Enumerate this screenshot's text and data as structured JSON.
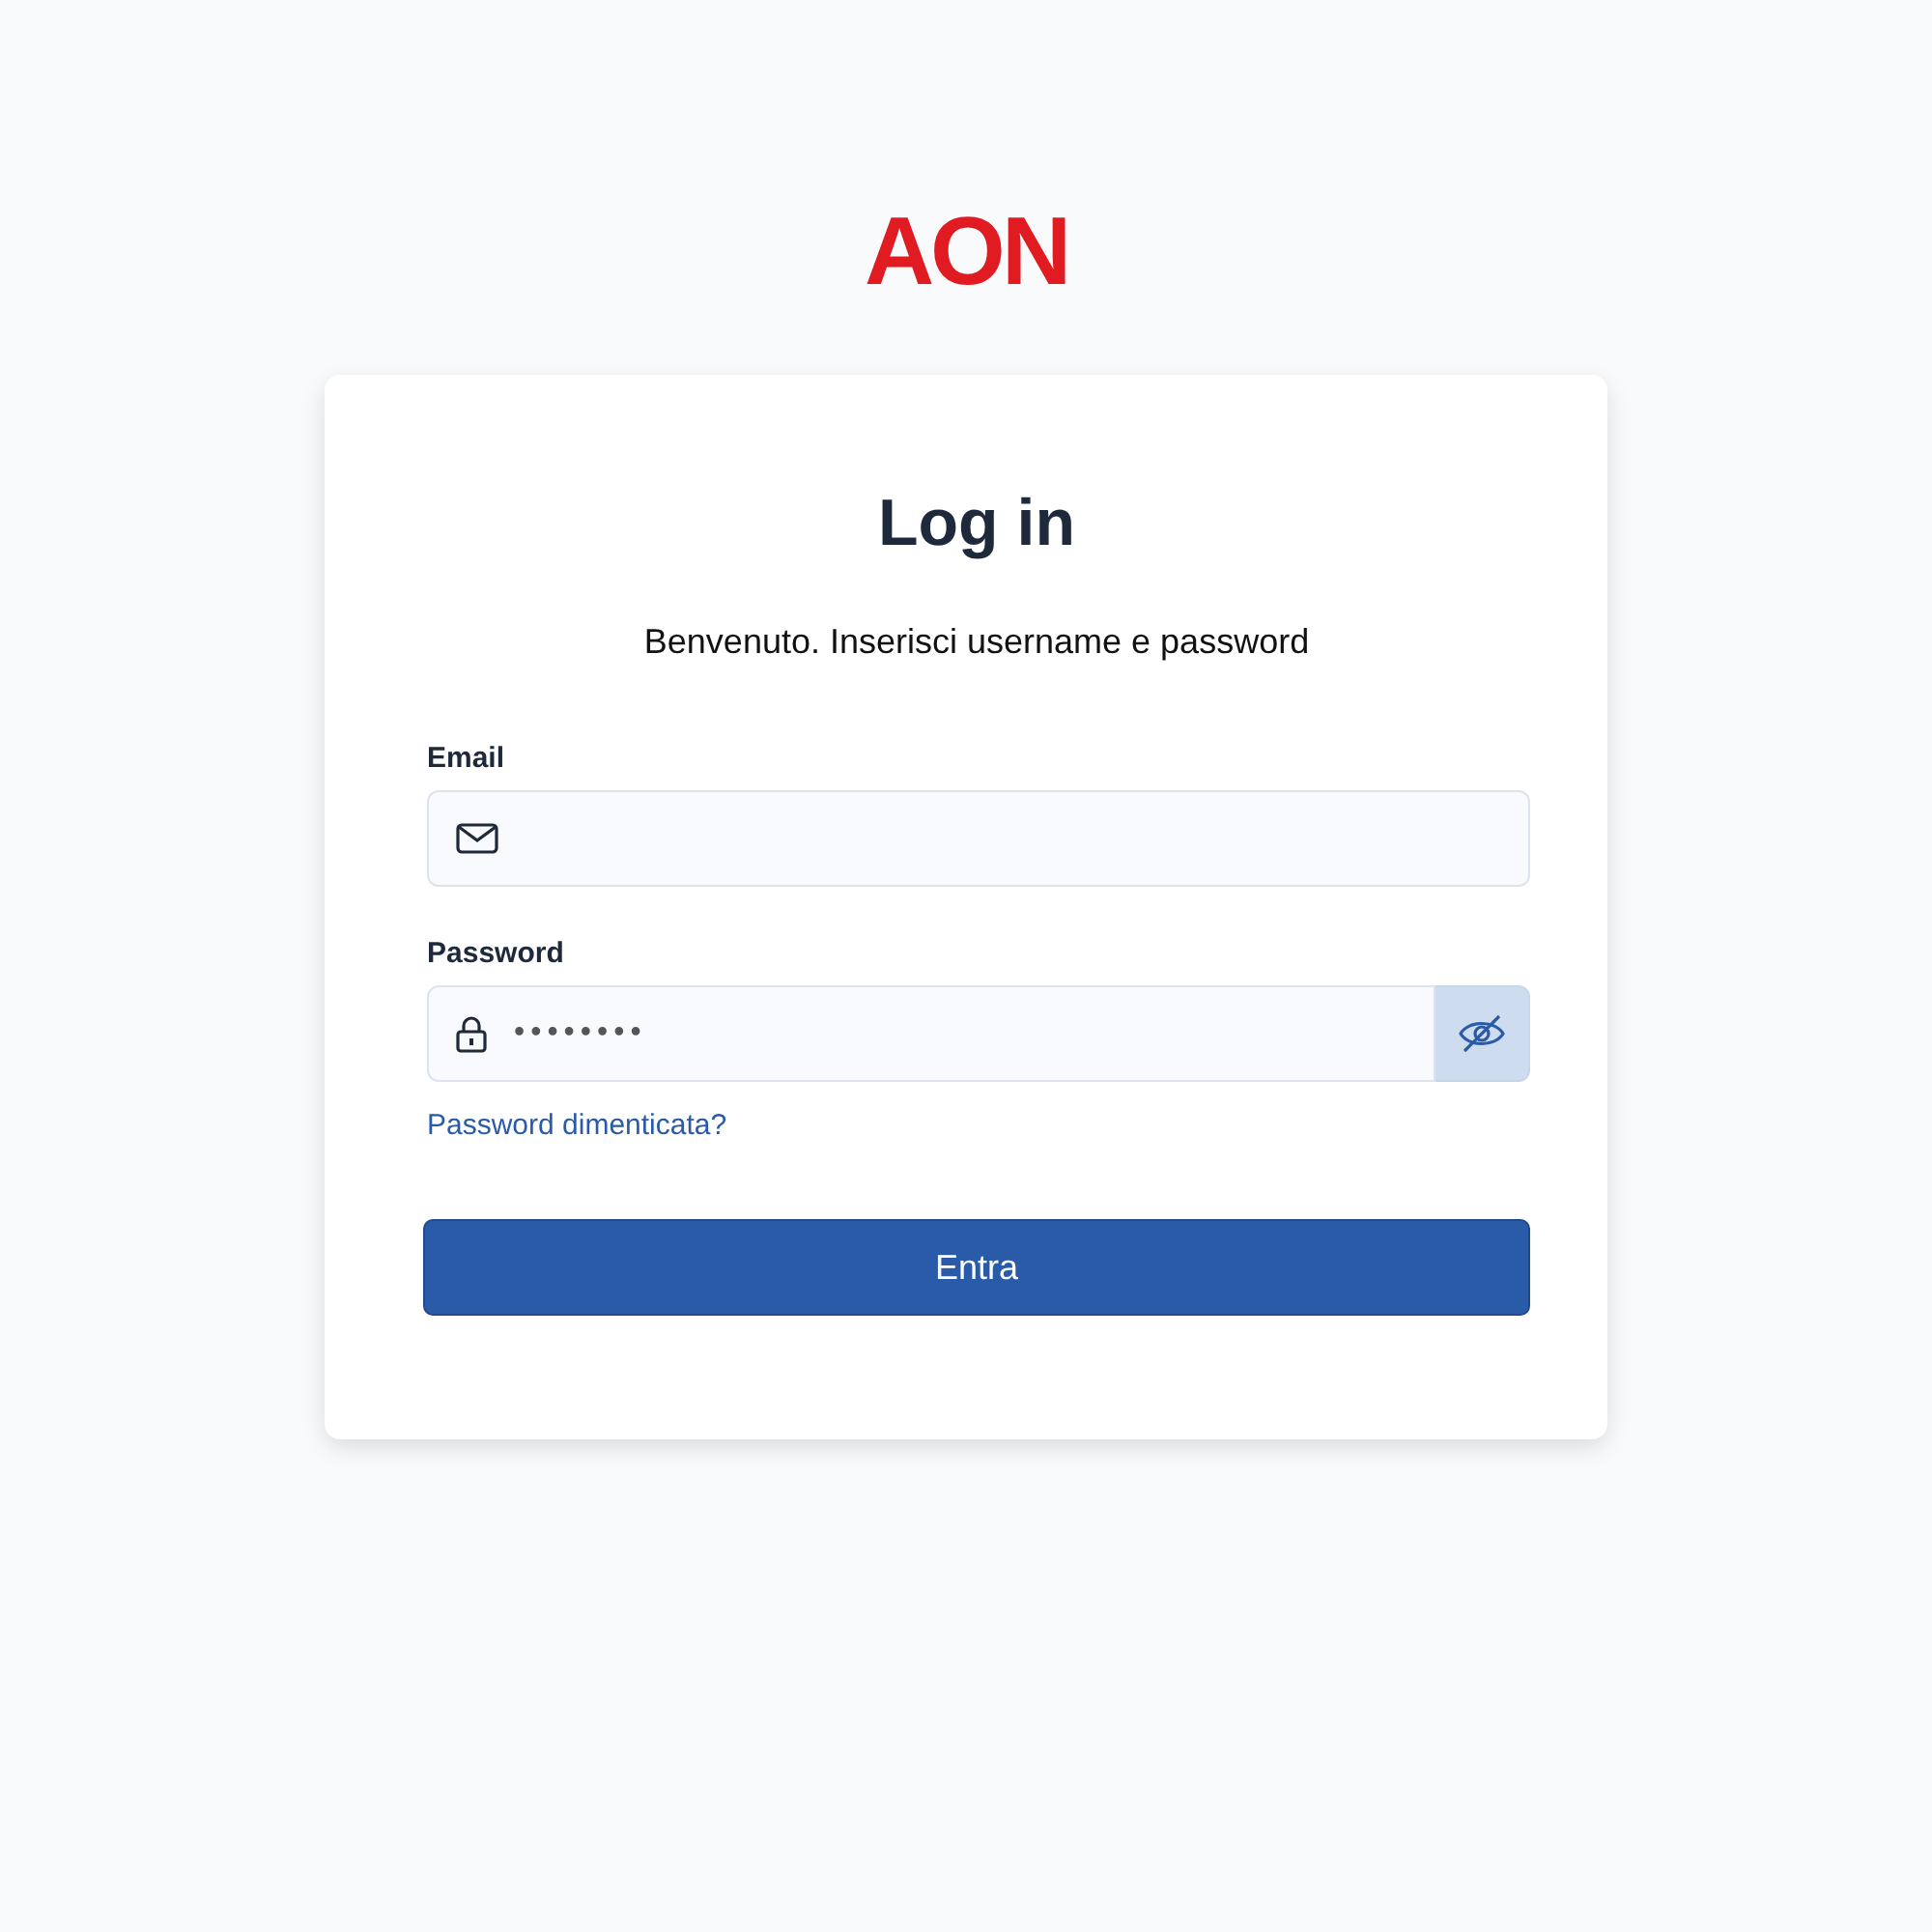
{
  "logo": "AON",
  "title": "Log in",
  "subtitle": "Benvenuto. Inserisci username e password",
  "email": {
    "label": "Email"
  },
  "password": {
    "label": "Password",
    "value": "••••••••",
    "visible": false
  },
  "forgot_link": "Password dimenticata?",
  "submit_button": "Entra"
}
